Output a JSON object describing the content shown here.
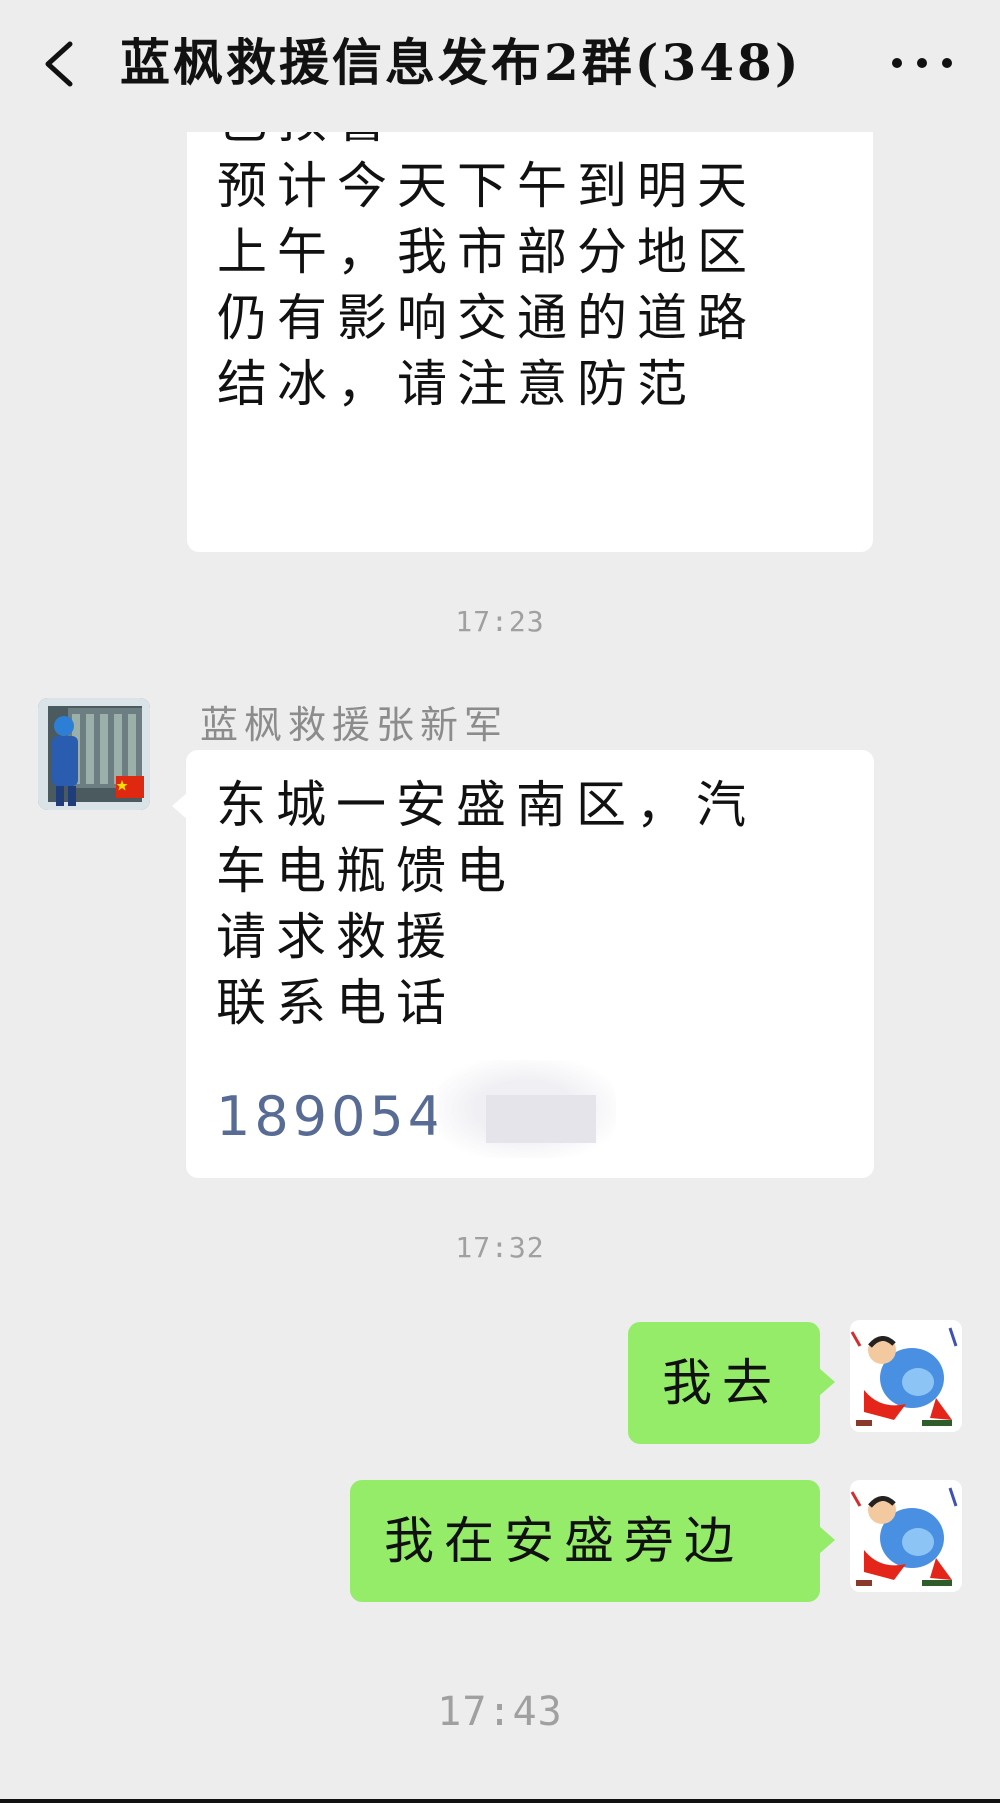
{
  "header": {
    "title": "蓝枫救援信息发布2群(348)",
    "back_icon": "chevron-left-icon",
    "more_icon": "more-icon"
  },
  "messages": [
    {
      "type": "incoming",
      "text": "色预警\n预计今天下午到明天\n上午，我市部分地区\n仍有影响交通的道路\n结冰，请注意防范"
    },
    {
      "type": "timestamp",
      "text": "17:23"
    },
    {
      "type": "incoming",
      "sender": "蓝枫救援张新军",
      "text": "东城一安盛南区，汽\n车电瓶馈电\n请求救援\n联系电话",
      "phone": "189054"
    },
    {
      "type": "timestamp",
      "text": "17:32"
    },
    {
      "type": "outgoing",
      "text": "我去"
    },
    {
      "type": "outgoing",
      "text": "我在安盛旁边"
    },
    {
      "type": "timestamp",
      "text": "17:43"
    }
  ],
  "colors": {
    "background": "#ededed",
    "bubble_incoming": "#ffffff",
    "bubble_outgoing": "#95ec69",
    "link": "#576b95"
  }
}
